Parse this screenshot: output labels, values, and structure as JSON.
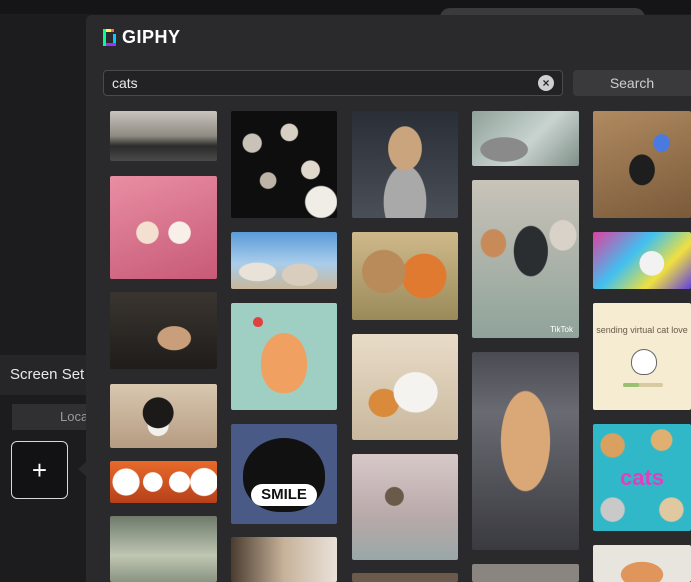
{
  "background": {
    "screen_label": "Screen Set",
    "tab_label": "Loca",
    "add_button": "+"
  },
  "giphy": {
    "logo_text": "GIPHY",
    "search": {
      "value": "cats",
      "placeholder": ""
    },
    "clear_icon": "×",
    "search_button": "Search",
    "gifs": {
      "virtual_love": "sending virtual cat love",
      "smile": "SMILE",
      "cats_text": "cats",
      "tiktok": "TikTok"
    }
  },
  "colors": {
    "panel": "#2a2a2c",
    "logo_green": "#00ff99",
    "logo_blue": "#00ccff",
    "logo_purple": "#9933ff",
    "logo_pink": "#ff6666",
    "logo_yellow": "#fff35c"
  }
}
